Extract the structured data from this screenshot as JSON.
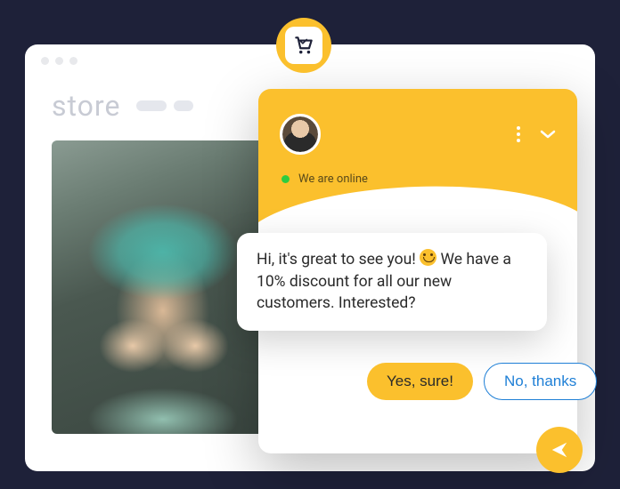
{
  "store": {
    "title": "store"
  },
  "chat": {
    "status_text": "We are online",
    "message": {
      "part1": "Hi, it's great to see you! ",
      "part2": " We have a 10% discount for all our new customers. Interested?"
    },
    "replies": {
      "yes": "Yes, sure!",
      "no": "No, thanks"
    }
  }
}
